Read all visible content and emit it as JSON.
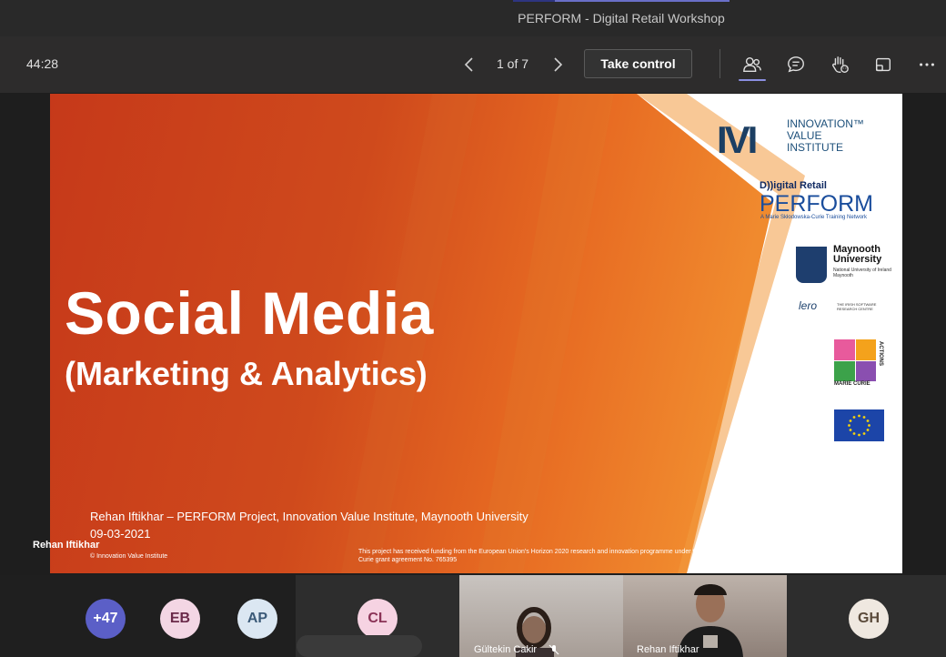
{
  "window": {
    "title": "PERFORM - Digital Retail Workshop"
  },
  "toolbar": {
    "timer": "44:28",
    "page_indicator": "1 of 7",
    "take_control_label": "Take control",
    "icons": [
      "chevron-left-icon",
      "chevron-right-icon",
      "people-icon",
      "chat-icon",
      "raise-hand-icon",
      "share-screen-icon",
      "more-icon"
    ]
  },
  "slide": {
    "title": "Social Media",
    "subtitle": "(Marketing & Analytics)",
    "author_line": "Rehan Iftikhar – PERFORM Project, Innovation Value Institute, Maynooth University",
    "date": "09-03-2021",
    "copyright": "© Innovation Value Institute",
    "funding": "This project has received funding from the European Union's Horizon 2020 research and innovation programme under the Marie Skłodowska-Curie grant agreement No. 765395",
    "logos": {
      "ivi_mark": "IVI",
      "ivi_text_1": "INNOVATION™",
      "ivi_text_2": "VALUE",
      "ivi_text_3": "INSTITUTE",
      "perform_small": "D))igital Retail",
      "perform_big": "PERFORM",
      "perform_sub": "A Marie Skłodowska-Curie Training Network",
      "mu_1": "Maynooth",
      "mu_2": "University",
      "mu_small": "National University of Ireland Maynooth",
      "lero": "lero",
      "lero_small": "THE IRISH SOFTWARE RESEARCH CENTRE",
      "mc_label": "MARIE CURIE",
      "mc_actions": "ACTIONS"
    },
    "colors": {
      "orange_dark": "#c6391a",
      "orange_light": "#ee7a26",
      "background": "#ffffff"
    }
  },
  "presenter_label": "Rehan Iftikhar",
  "participants": [
    {
      "initials": "+47",
      "bg": "#5b5fc7",
      "fg": "#ffffff"
    },
    {
      "initials": "EB",
      "bg": "#f3d6e4",
      "fg": "#6b2a4a"
    },
    {
      "initials": "AP",
      "bg": "#dbe7f2",
      "fg": "#3b5a78"
    },
    {
      "initials": "CL",
      "bg": "#f6d3e2",
      "fg": "#8a3256"
    },
    {
      "name": "Gültekin Cakir"
    },
    {
      "name": "Rehan Iftikhar"
    },
    {
      "initials": "GH",
      "bg": "#efe8e0",
      "fg": "#5a4a3a"
    }
  ]
}
